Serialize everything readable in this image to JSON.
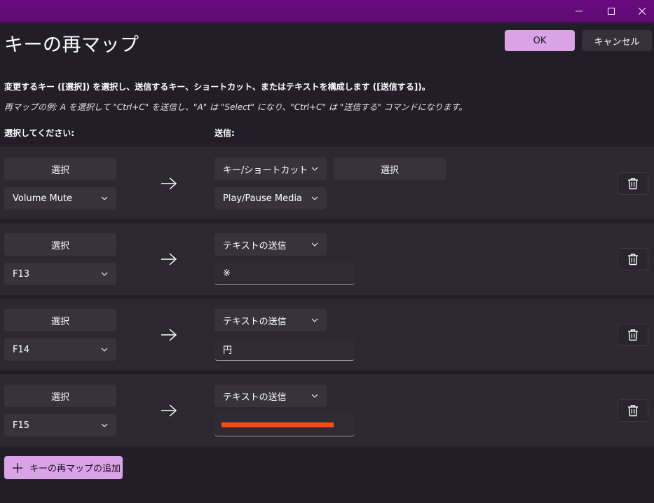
{
  "window": {
    "controls": [
      "minimize-icon",
      "maximize-icon",
      "close-icon"
    ]
  },
  "header": {
    "title": "キーの再マップ",
    "ok_label": "OK",
    "cancel_label": "キャンセル"
  },
  "description": "変更するキー ([選択]) を選択し、送信するキー、ショートカット、またはテキストを構成します ([送信する])。",
  "example": "再マップの例: A を選択して \"Ctrl+C\" を送信し、\"A\" は \"Select\" になり、\"Ctrl+C\" は \"送信する\" コマンドになります。",
  "columns": {
    "select": "選択してください:",
    "send": "送信:"
  },
  "rows": [
    {
      "select_button": "選択",
      "source_key": "Volume Mute",
      "action_type": "キー/ショートカットの送",
      "target_select_button": "選択",
      "target_key": "Play/Pause Media"
    },
    {
      "select_button": "選択",
      "source_key": "F13",
      "action_type": "テキストの送信",
      "text_value": "※"
    },
    {
      "select_button": "選択",
      "source_key": "F14",
      "action_type": "テキストの送信",
      "text_value": "円"
    },
    {
      "select_button": "選択",
      "source_key": "F15",
      "action_type": "テキストの送信",
      "text_value": ""
    }
  ],
  "add_button": "キーの再マップの追加",
  "colors": {
    "titlebar": "#5d0a73",
    "accent": "#d9a3e6",
    "background": "#221e27",
    "row": "#2c2830",
    "redaction": "#ff4a12"
  }
}
